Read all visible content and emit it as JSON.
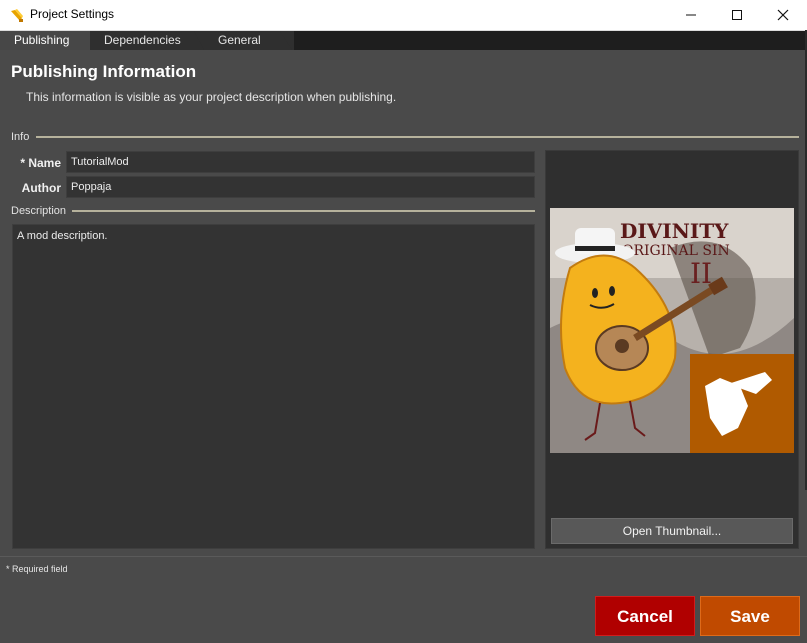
{
  "window": {
    "title": "Project Settings",
    "minimize_icon": "minimize-icon",
    "maximize_icon": "maximize-icon",
    "close_icon": "close-icon"
  },
  "tabs": [
    {
      "label": "Publishing",
      "active": true
    },
    {
      "label": "Dependencies",
      "active": false
    },
    {
      "label": "General",
      "active": false
    }
  ],
  "header": {
    "title": "Publishing Information",
    "subtitle": "This information is visible as your project description when publishing."
  },
  "info_section": {
    "label": "Info",
    "name_label": "* Name",
    "name_value": "TutorialMod",
    "author_label": "Author",
    "author_value": "Poppaja"
  },
  "description_section": {
    "label": "Description",
    "value": "A mod description."
  },
  "thumbnail": {
    "button_label": "Open Thumbnail..."
  },
  "footer": {
    "required_note": "* Required field",
    "cancel_label": "Cancel",
    "save_label": "Save"
  },
  "colors": {
    "background": "#4a4a4a",
    "cancel": "#b00000",
    "save": "#c04a00",
    "rule": "#b6b29c"
  }
}
